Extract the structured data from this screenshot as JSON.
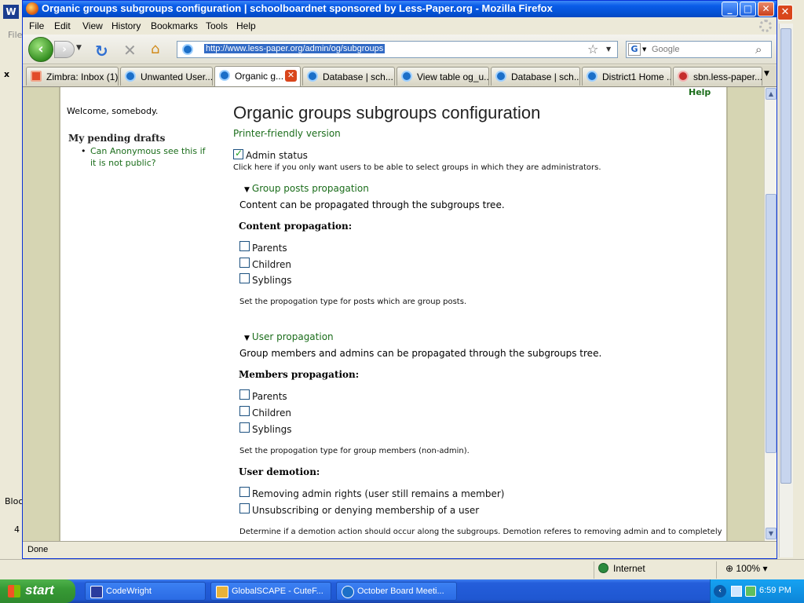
{
  "window": {
    "title": "Organic groups subgroups configuration | schoolboardnet sponsored by Less-Paper.org - Mozilla Firefox",
    "min": "_",
    "max": "□",
    "close": "✕"
  },
  "menu": {
    "file": "File",
    "edit": "Edit",
    "view": "View",
    "history": "History",
    "bookmarks": "Bookmarks",
    "tools": "Tools",
    "help": "Help"
  },
  "nav": {
    "url": "http://www.less-paper.org/admin/og/subgroups",
    "search_placeholder": "Google",
    "search_engine_letter": "G"
  },
  "tabs": [
    {
      "label": "Zimbra: Inbox (1)"
    },
    {
      "label": "Unwanted User..."
    },
    {
      "label": "Organic g..."
    },
    {
      "label": "Database | sch..."
    },
    {
      "label": "View table og_u..."
    },
    {
      "label": "Database | sch..."
    },
    {
      "label": "District1 Home ..."
    },
    {
      "label": "sbn.less-paper...."
    }
  ],
  "sidebar": {
    "welcome": "Welcome, somebody.",
    "drafts_title": "My pending drafts",
    "drafts": [
      "Can Anonymous see this if it is not public?"
    ]
  },
  "main": {
    "help": "Help",
    "title": "Organic groups subgroups configuration",
    "printer_friendly": "Printer-friendly version",
    "admin_status": {
      "label": "Admin status",
      "checked": true,
      "desc": "Click here if you only want users to be able to select groups in which they are administrators."
    },
    "group_posts": {
      "legend": "Group posts propagation",
      "desc": "Content can be propagated through the subgroups tree.",
      "heading": "Content propagation:",
      "options": [
        "Parents",
        "Children",
        "Syblings"
      ],
      "help": "Set the propogation type for posts which are group posts."
    },
    "user_prop": {
      "legend": "User propagation",
      "desc": "Group members and admins can be propagated through the subgroups tree.",
      "heading": "Members propagation:",
      "options": [
        "Parents",
        "Children",
        "Syblings"
      ],
      "help": "Set the propogation type for group members (non-admin).",
      "demotion_heading": "User demotion:",
      "demotion_options": [
        "Removing admin rights (user still remains a member)",
        "Unsubscribing or denying membership of a user"
      ],
      "demotion_help": "Determine if a demotion action should occur along the subgroups. Demotion referes to removing admin and to completely"
    }
  },
  "status": {
    "done": "Done",
    "zone": "Internet",
    "zoom": "100%"
  },
  "background": {
    "file_menu": "File",
    "x_label": "x",
    "blo_label": "Bloc",
    "row_num": "4"
  },
  "taskbar": {
    "start": "start",
    "tasks": [
      "CodeWright",
      "GlobalSCAPE - CuteF...",
      "October Board Meeti..."
    ],
    "clock": "6:59 PM"
  }
}
